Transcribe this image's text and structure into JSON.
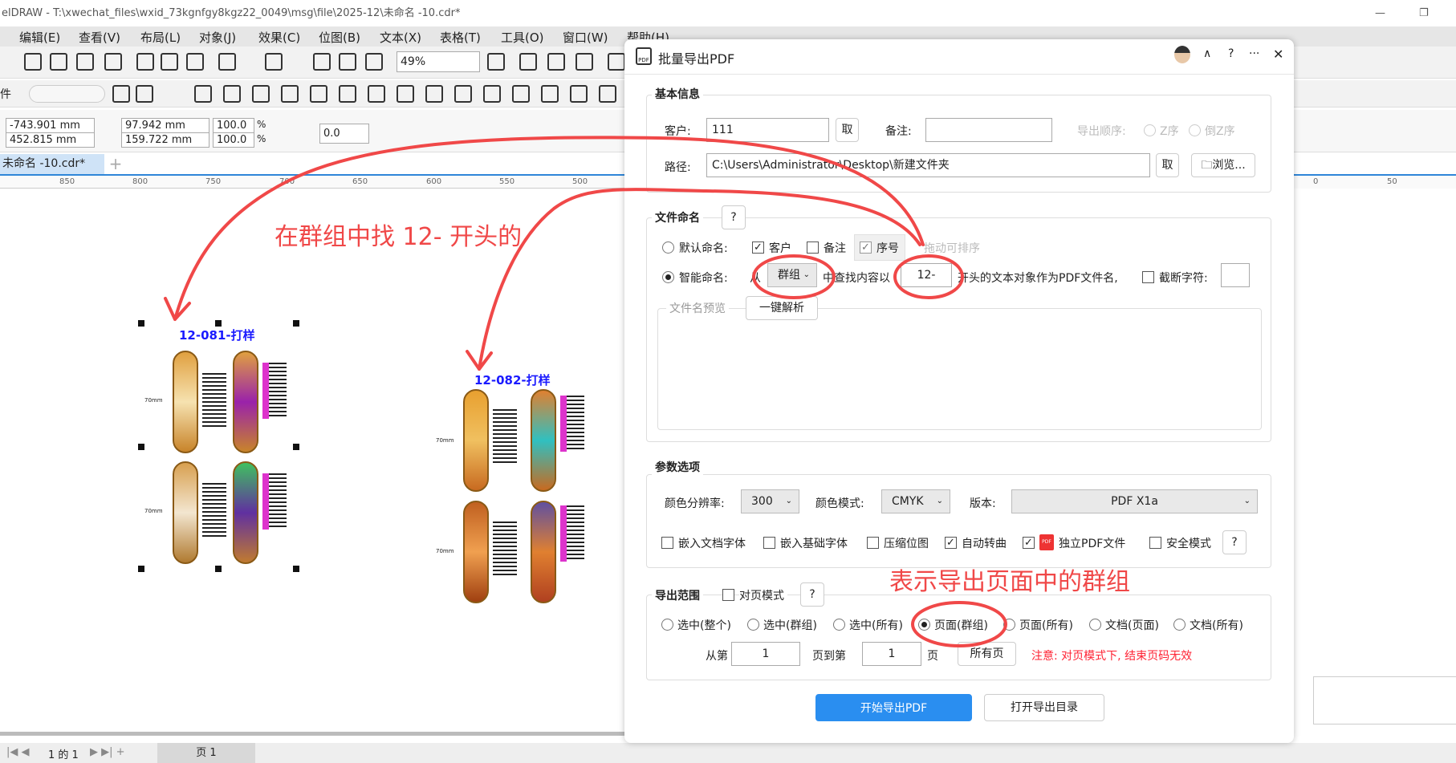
{
  "window": {
    "title": "elDRAW - T:\\xwechat_files\\wxid_73kgnfgy8kgz22_0049\\msg\\file\\2025-12\\未命名 -10.cdr*"
  },
  "menu": [
    "编辑(E)",
    "查看(V)",
    "布局(L)",
    "对象(J)",
    "效果(C)",
    "位图(B)",
    "文本(X)",
    "表格(T)",
    "工具(O)",
    "窗口(W)",
    "帮助(H)"
  ],
  "toolbar": {
    "zoom": "49%",
    "toolbar2_label": "件"
  },
  "toolbar_icons": [
    "save-icon",
    "cloud-download-icon",
    "cloud-upload-icon",
    "print-icon",
    "copy-format-icon",
    "copy-icon",
    "paste-icon",
    "undo-icon",
    "redo-icon",
    "import-icon",
    "export-icon",
    "pdf-icon",
    "zoom-fit-icon",
    "rulers-icon",
    "grid-icon",
    "guidelines-icon",
    "close-doc-icon"
  ],
  "toolbar2_icons": [
    "clock-icon",
    "sort-icon",
    "pdf-export-icon",
    "pen-icon",
    "image-icon",
    "barcode-icon",
    "frame-icon",
    "network-icon",
    "crop-icon",
    "edit-icon",
    "magic-icon",
    "roll-icon",
    "square-icon",
    "star-icon",
    "node-icon",
    "pdf-down-icon",
    "char-icon",
    "card-icon",
    "dots-icon"
  ],
  "props": {
    "x": "-743.901 mm",
    "y": "452.815 mm",
    "w": "97.942 mm",
    "h": "159.722 mm",
    "sx": "100.0",
    "sy": "100.0",
    "pct": "%",
    "rotation": "0.0"
  },
  "doc_tab": "未命名 -10.cdr*",
  "ruler": [
    "850",
    "800",
    "750",
    "700",
    "650",
    "600",
    "550",
    "500",
    "0",
    "50"
  ],
  "status": {
    "page_of": "1  的  1",
    "page_tab": "页 1"
  },
  "canvas": {
    "group1": "12-081-打样",
    "group2": "12-082-打样",
    "dim": "70mm"
  },
  "annotations": {
    "a1": "在群组中找 12-  开头的",
    "a2": "表示导出页面中的群组"
  },
  "dialog": {
    "title": "批量导出PDF",
    "basic": {
      "title": "基本信息",
      "customer_label": "客户:",
      "customer": "111",
      "take": "取",
      "note_label": "备注:",
      "note": "",
      "order_label": "导出顺序:",
      "z": "Z序",
      "rz": "倒Z序",
      "path_label": "路径:",
      "path": "C:\\Users\\Administrator\\Desktop\\新建文件夹",
      "take2": "取",
      "browse": "浏览..."
    },
    "naming": {
      "title": "文件命名",
      "help": "?",
      "default": "默认命名:",
      "cb_customer": "客户",
      "cb_note": "备注",
      "cb_seq": "序号",
      "drag": "拖动可排序",
      "smart": "智能命名:",
      "from": "从",
      "source": "群组",
      "find": "中查找内容以",
      "prefix": "12-",
      "suffix": "开头的文本对象作为PDF文件名,",
      "trunc": "截断字符:",
      "preview": "文件名预览",
      "parse": "一键解析"
    },
    "params": {
      "title": "参数选项",
      "res_label": "颜色分辨率:",
      "res": "300",
      "mode_label": "颜色模式:",
      "mode": "CMYK",
      "ver_label": "版本:",
      "ver": "PDF X1a",
      "opts": [
        "嵌入文档字体",
        "嵌入基础字体",
        "压缩位图",
        "自动转曲",
        "独立PDF文件",
        "安全模式"
      ],
      "help": "?"
    },
    "range": {
      "title": "导出范围",
      "facing": "对页模式",
      "help": "?",
      "radios": [
        "选中(整个)",
        "选中(群组)",
        "选中(所有)",
        "页面(群组)",
        "页面(所有)",
        "文档(页面)",
        "文档(所有)"
      ],
      "from": "从第",
      "from_val": "1",
      "to": "页到第",
      "to_val": "1",
      "page": "页",
      "all": "所有页",
      "note": "注意: 对页模式下, 结束页码无效"
    },
    "start": "开始导出PDF",
    "open": "打开导出目录"
  }
}
